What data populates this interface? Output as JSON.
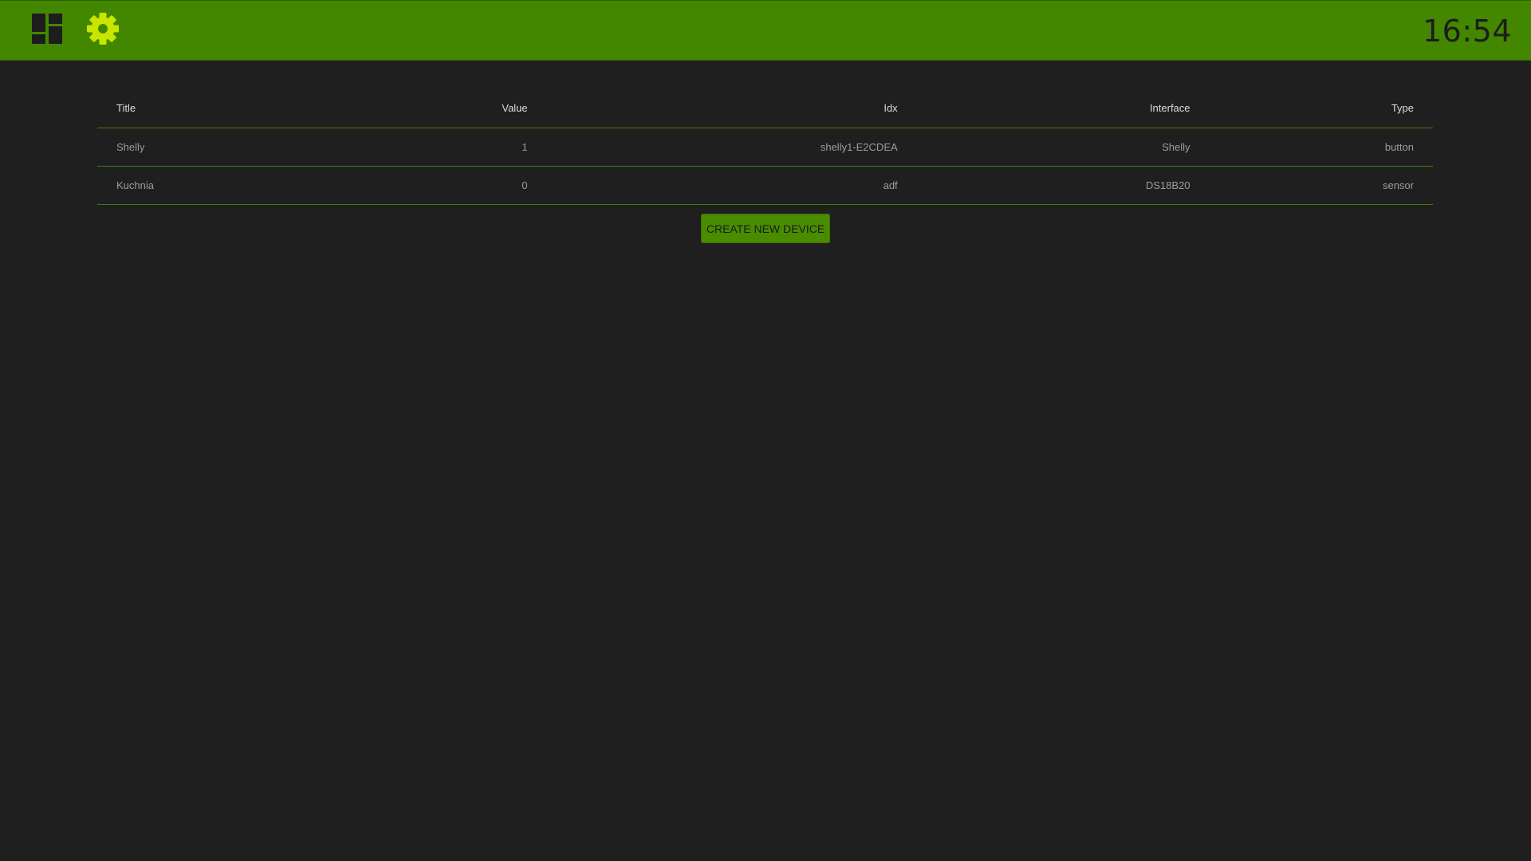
{
  "header": {
    "clock": "16:54",
    "icons": {
      "dashboard": "dashboard-icon",
      "settings": "gear-icon"
    },
    "colors": {
      "bar": "#438700",
      "accent": "#c8e600",
      "icon_dark": "#1d1d1d"
    }
  },
  "devices_table": {
    "columns": [
      "Title",
      "Value",
      "Idx",
      "Interface",
      "Type"
    ],
    "rows": [
      {
        "title": "Shelly",
        "value": "1",
        "idx": "shelly1-E2CDEA",
        "interface": "Shelly",
        "type": "button"
      },
      {
        "title": "Kuchnia",
        "value": "0",
        "idx": "adf",
        "interface": "DS18B20",
        "type": "sensor"
      }
    ]
  },
  "actions": {
    "create_label": "CREATE NEW DEVICE"
  }
}
